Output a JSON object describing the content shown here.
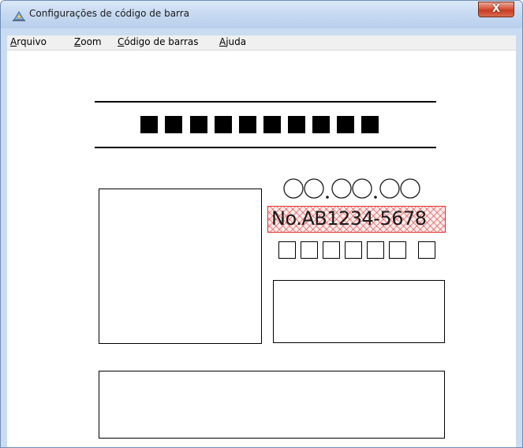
{
  "window": {
    "title": "Configurações de código de barra",
    "close_label": "X"
  },
  "menu": [
    {
      "accel": "A",
      "rest": "rquivo"
    },
    {
      "accel": "Z",
      "rest": "oom"
    },
    {
      "accel": "C",
      "rest": "ódigo de barras"
    },
    {
      "accel": "A",
      "rest": "juda"
    }
  ],
  "canvas": {
    "number_field_text": "No.AB1234-5678",
    "barcode_block_count": 10,
    "digit_circle_placeholder": "○○.○○.○○",
    "digit_square_count": 7
  },
  "colors": {
    "hatch": "#e43030",
    "titlebar": "#c6d9f1"
  }
}
